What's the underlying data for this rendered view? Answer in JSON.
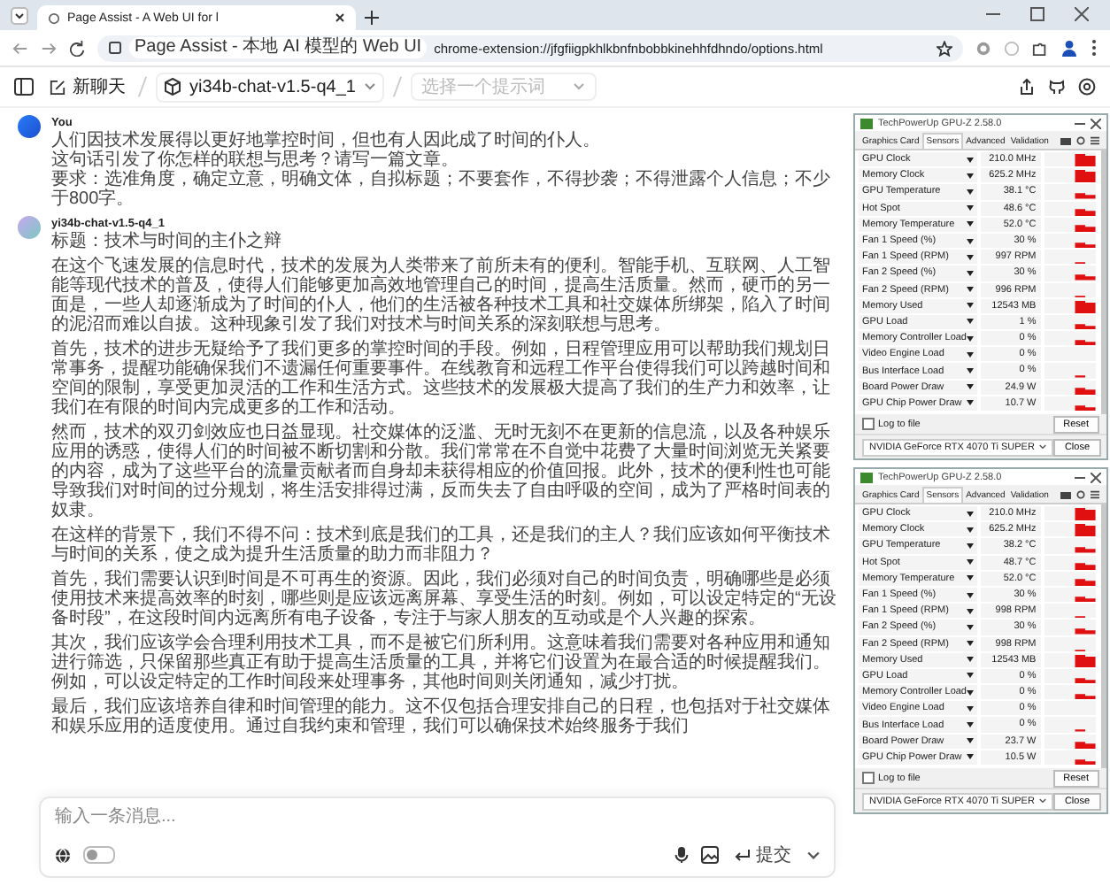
{
  "browser": {
    "tab": {
      "title": "Page Assist - A Web UI for l",
      "selected": true
    },
    "address": {
      "page_title": "Page Assist - 本地 AI 模型的 Web UI",
      "url": "chrome-extension://jfgfiigpkhlkbnfnbobbkinehhfdhndo/options.html"
    }
  },
  "toolbar": {
    "new_chat": "新聊天",
    "model": "yi34b-chat-v1.5-q4_1",
    "prompt_select": {
      "placeholder": "选择一个提示词"
    }
  },
  "messages": [
    {
      "kind": "user",
      "author": "You",
      "paragraphs": [
        "人们因技术发展得以更好地掌控时间，但也有人因此成了时间的仆人。",
        "这句话引发了你怎样的联想与思考？请写一篇文章。",
        "要求：选准角度，确定立意，明确文体，自拟标题；不要套作，不得抄袭；不得泄露个人信息；不少于800字。"
      ]
    },
    {
      "kind": "assistant",
      "author": "yi34b-chat-v1.5-q4_1",
      "paragraphs": [
        "标题：技术与时间的主仆之辩",
        "在这个飞速发展的信息时代，技术的发展为人类带来了前所未有的便利。智能手机、互联网、人工智能等现代技术的普及，使得人们能够更加高效地管理自己的时间，提高生活质量。然而，硬币的另一面是，一些人却逐渐成为了时间的仆人，他们的生活被各种技术工具和社交媒体所绑架，陷入了时间的泥沼而难以自拔。这种现象引发了我们对技术与时间关系的深刻联想与思考。",
        "首先，技术的进步无疑给予了我们更多的掌控时间的手段。例如，日程管理应用可以帮助我们规划日常事务，提醒功能确保我们不遗漏任何重要事件。在线教育和远程工作平台使得我们可以跨越时间和空间的限制，享受更加灵活的工作和生活方式。这些技术的发展极大提高了我们的生产力和效率，让我们在有限的时间内完成更多的工作和活动。",
        "然而，技术的双刃剑效应也日益显现。社交媒体的泛滥、无时无刻不在更新的信息流，以及各种娱乐应用的诱惑，使得人们的时间被不断切割和分散。我们常常在不自觉中花费了大量时间浏览无关紧要的内容，成为了这些平台的流量贡献者而自身却未获得相应的价值回报。此外，技术的便利性也可能导致我们对时间的过分规划，将生活安排得过满，反而失去了自由呼吸的空间，成为了严格时间表的奴隶。",
        "在这样的背景下，我们不得不问：技术到底是我们的工具，还是我们的主人？我们应该如何平衡技术与时间的关系，使之成为提升生活质量的助力而非阻力？",
        "首先，我们需要认识到时间是不可再生的资源。因此，我们必须对自己的时间负责，明确哪些是必须使用技术来提高效率的时刻，哪些则是应该远离屏幕、享受生活的时刻。例如，可以设定特定的“无设备时段”，在这段时间内远离所有电子设备，专注于与家人朋友的互动或是个人兴趣的探索。",
        "其次，我们应该学会合理利用技术工具，而不是被它们所利用。这意味着我们需要对各种应用和通知进行筛选，只保留那些真正有助于提高生活质量的工具，并将它们设置为在最合适的时候提醒我们。例如，可以设定特定的工作时间段来处理事务，其他时间则关闭通知，减少打扰。",
        "最后，我们应该培养自律和时间管理的能力。这不仅包括合理安排自己的日程，也包括对于社交媒体和娱乐应用的适度使用。通过自我约束和管理，我们可以确保技术始终服务于我们"
      ]
    }
  ],
  "composer": {
    "placeholder": "输入一条消息...",
    "toggle": {
      "on": false
    },
    "submit": "提交"
  },
  "gpuz_windows": [
    {
      "title": "TechPowerUp GPU-Z 2.58.0",
      "tabs": [
        {
          "label": "Graphics Card",
          "selected": false
        },
        {
          "label": "Sensors",
          "selected": true
        },
        {
          "label": "Advanced",
          "selected": false
        },
        {
          "label": "Validation",
          "selected": false
        }
      ],
      "sensors": [
        {
          "name": "GPU Clock",
          "value": "210.0 MHz"
        },
        {
          "name": "Memory Clock",
          "value": "625.2 MHz"
        },
        {
          "name": "GPU Temperature",
          "value": "38.1 °C"
        },
        {
          "name": "Hot Spot",
          "value": "48.6 °C"
        },
        {
          "name": "Memory Temperature",
          "value": "52.0 °C"
        },
        {
          "name": "Fan 1 Speed (%)",
          "value": "30 %"
        },
        {
          "name": "Fan 1 Speed (RPM)",
          "value": "997 RPM"
        },
        {
          "name": "Fan 2 Speed (%)",
          "value": "30 %"
        },
        {
          "name": "Fan 2 Speed (RPM)",
          "value": "996 RPM"
        },
        {
          "name": "Memory Used",
          "value": "12543 MB"
        },
        {
          "name": "GPU Load",
          "value": "1 %"
        },
        {
          "name": "Memory Controller Load",
          "value": "0 %"
        },
        {
          "name": "Video Engine Load",
          "value": "0 %"
        },
        {
          "name": "Bus Interface Load",
          "value": "0 %"
        },
        {
          "name": "Board Power Draw",
          "value": "24.9 W"
        },
        {
          "name": "GPU Chip Power Draw",
          "value": "10.7 W"
        }
      ],
      "log_to_file": {
        "label": "Log to file",
        "checked": false
      },
      "reset": "Reset",
      "gpu": "NVIDIA GeForce RTX 4070 Ti SUPER",
      "close": "Close"
    },
    {
      "title": "TechPowerUp GPU-Z 2.58.0",
      "tabs": [
        {
          "label": "Graphics Card",
          "selected": false
        },
        {
          "label": "Sensors",
          "selected": true
        },
        {
          "label": "Advanced",
          "selected": false
        },
        {
          "label": "Validation",
          "selected": false
        }
      ],
      "sensors": [
        {
          "name": "GPU Clock",
          "value": "210.0 MHz"
        },
        {
          "name": "Memory Clock",
          "value": "625.2 MHz"
        },
        {
          "name": "GPU Temperature",
          "value": "38.2 °C"
        },
        {
          "name": "Hot Spot",
          "value": "48.7 °C"
        },
        {
          "name": "Memory Temperature",
          "value": "52.0 °C"
        },
        {
          "name": "Fan 1 Speed (%)",
          "value": "30 %"
        },
        {
          "name": "Fan 1 Speed (RPM)",
          "value": "998 RPM"
        },
        {
          "name": "Fan 2 Speed (%)",
          "value": "30 %"
        },
        {
          "name": "Fan 2 Speed (RPM)",
          "value": "998 RPM"
        },
        {
          "name": "Memory Used",
          "value": "12543 MB"
        },
        {
          "name": "GPU Load",
          "value": "0 %"
        },
        {
          "name": "Memory Controller Load",
          "value": "0 %"
        },
        {
          "name": "Video Engine Load",
          "value": "0 %"
        },
        {
          "name": "Bus Interface Load",
          "value": "0 %"
        },
        {
          "name": "Board Power Draw",
          "value": "23.7 W"
        },
        {
          "name": "GPU Chip Power Draw",
          "value": "10.5 W"
        }
      ],
      "log_to_file": {
        "label": "Log to file",
        "checked": false
      },
      "reset": "Reset",
      "gpu": "NVIDIA GeForce RTX 4070 Ti SUPER",
      "close": "Close"
    }
  ]
}
